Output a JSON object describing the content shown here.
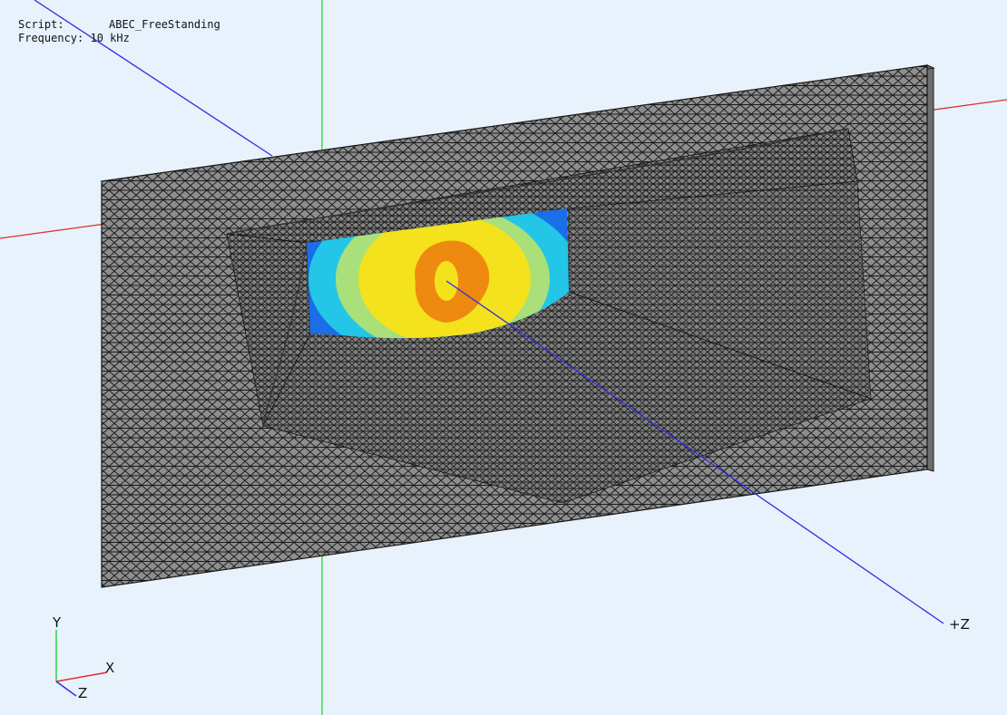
{
  "info": {
    "script_label": "Script:",
    "script_value": "ABEC_FreeStanding",
    "frequency_label": "Frequency:",
    "frequency_value": "10 kHz"
  },
  "axes": {
    "z_axis_label": "+Z",
    "triad_y": "Y",
    "triad_x": "X",
    "triad_z": "Z"
  },
  "colors": {
    "background": "#e8f2fd",
    "mesh_fill": "#8e8e8e",
    "mesh_lines": "#1a1a1a",
    "axis_x": "#e03030",
    "axis_y": "#30d040",
    "axis_z": "#3030e0",
    "field_blue": "#1a6ee8",
    "field_cyan": "#23c6e6",
    "field_green": "#a9e07a",
    "field_yellow": "#f4e21c",
    "field_orange": "#ef8a10"
  }
}
